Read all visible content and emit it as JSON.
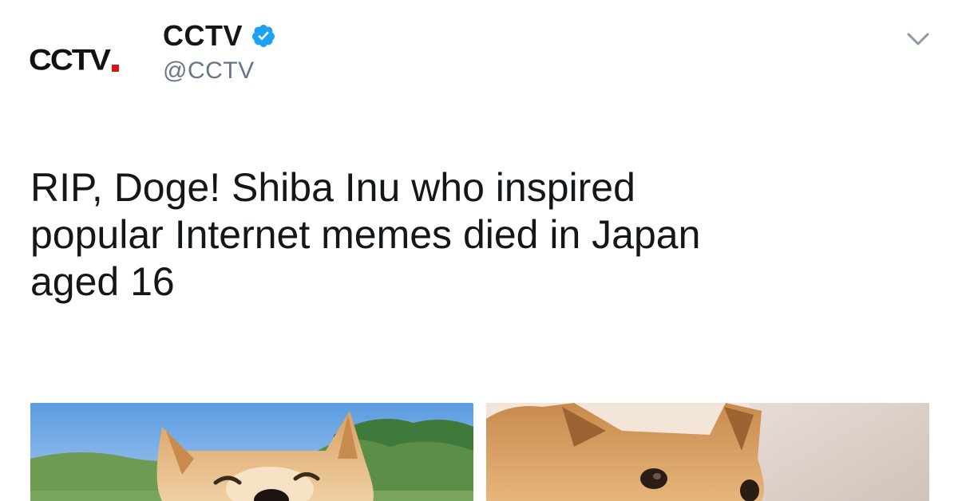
{
  "tweet": {
    "avatar": {
      "logo_text": "CCTV",
      "logo_color": "#111111",
      "dot_color": "#d8141b"
    },
    "user": {
      "display_name": "CCTV",
      "handle": "@CCTV",
      "verified": true,
      "verified_color": "#1da1f2"
    },
    "menu_icon": "chevron-down-icon",
    "text": "RIP, Doge! Shiba Inu who inspired\npopular Internet memes died in Japan\naged 16",
    "media": [
      {
        "icon": "photo-shiba-smiling-outdoors"
      },
      {
        "icon": "photo-shiba-closeup-indoors"
      }
    ]
  }
}
